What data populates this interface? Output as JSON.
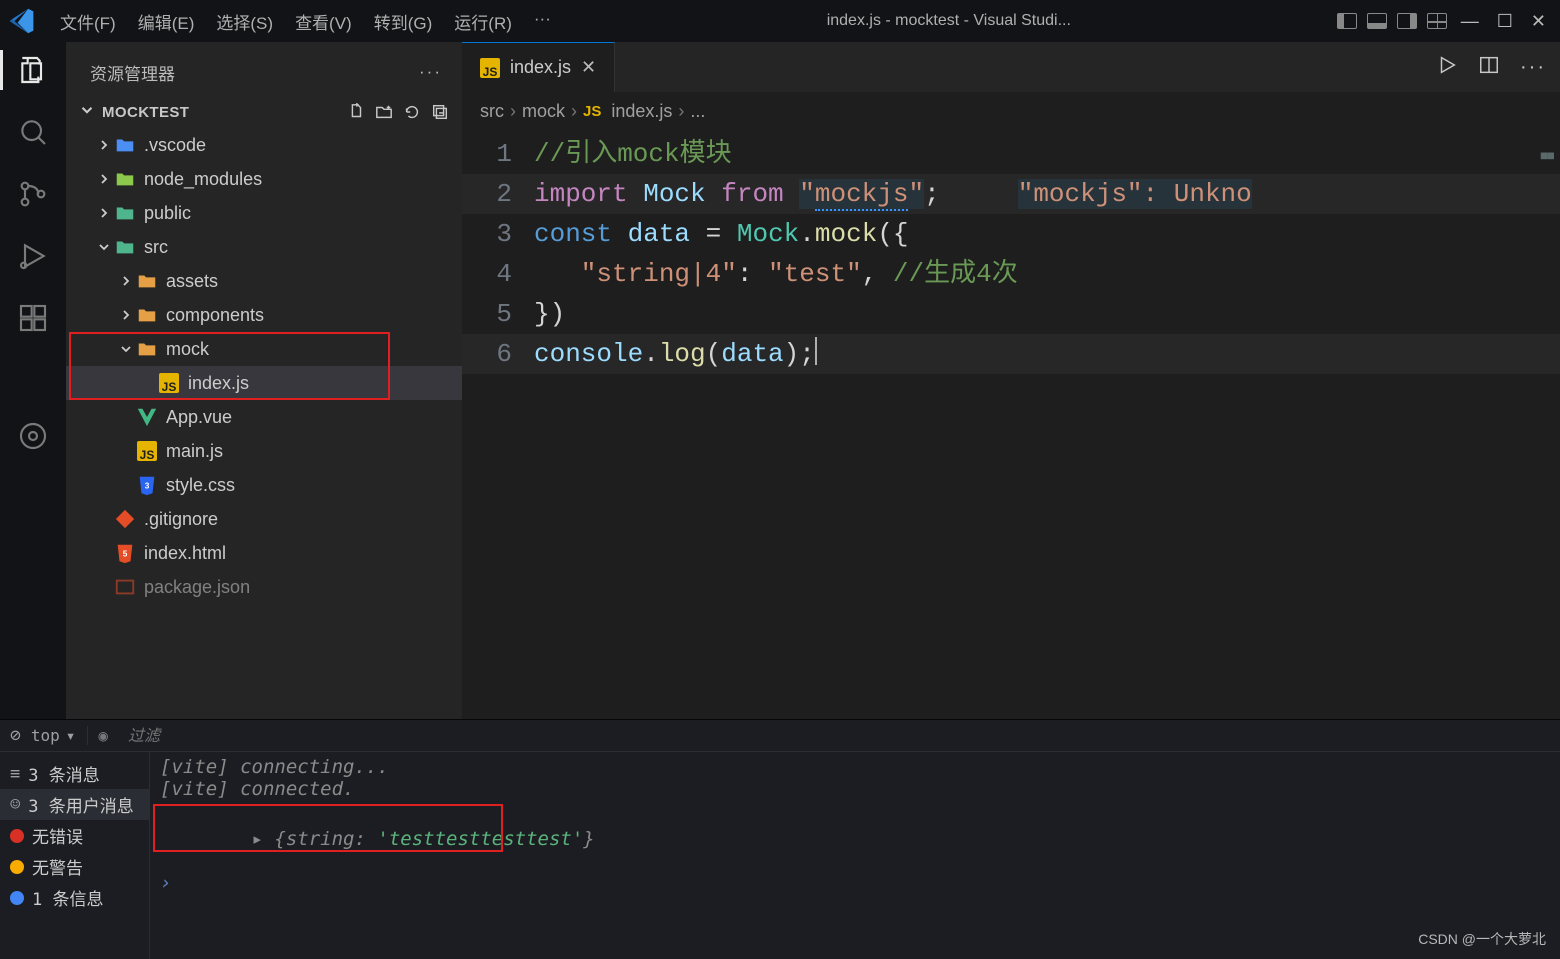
{
  "titlebar": {
    "menus": [
      "文件(F)",
      "编辑(E)",
      "选择(S)",
      "查看(V)",
      "转到(G)",
      "运行(R)",
      "···"
    ],
    "title": "index.js - mocktest - Visual Studi...",
    "win": {
      "min": "—",
      "max": "☐",
      "close": "✕"
    }
  },
  "sidebar": {
    "header": "资源管理器",
    "project": "MOCKTEST",
    "tools": {
      "newfile": "+",
      "newfolder": "+",
      "refresh": "↻",
      "collapse": "⊟"
    },
    "tree": [
      {
        "depth": 1,
        "tw": ">",
        "icon": "folder-vscode",
        "label": ".vscode",
        "name": "tree-vscode",
        "color": "#4b8ff5"
      },
      {
        "depth": 1,
        "tw": ">",
        "icon": "folder-node",
        "label": "node_modules",
        "name": "tree-node-modules",
        "color": "#8cc84b"
      },
      {
        "depth": 1,
        "tw": ">",
        "icon": "folder-public",
        "label": "public",
        "name": "tree-public",
        "color": "#4fb58d"
      },
      {
        "depth": 1,
        "tw": "v",
        "icon": "folder-src",
        "label": "src",
        "name": "tree-src",
        "color": "#4fb58d"
      },
      {
        "depth": 2,
        "tw": ">",
        "icon": "folder-assets",
        "label": "assets",
        "name": "tree-assets",
        "color": "#e59f45"
      },
      {
        "depth": 2,
        "tw": ">",
        "icon": "folder-comp",
        "label": "components",
        "name": "tree-components",
        "color": "#e59f45"
      },
      {
        "depth": 2,
        "tw": "v",
        "icon": "folder-open",
        "label": "mock",
        "name": "tree-mock",
        "color": "#e59f45",
        "boxstart": true
      },
      {
        "depth": 3,
        "tw": "",
        "icon": "js",
        "label": "index.js",
        "name": "tree-index-js",
        "sel": true,
        "boxend": true
      },
      {
        "depth": 2,
        "tw": "",
        "icon": "vue",
        "label": "App.vue",
        "name": "tree-app-vue",
        "color": "#41b883"
      },
      {
        "depth": 2,
        "tw": "",
        "icon": "js",
        "label": "main.js",
        "name": "tree-main-js"
      },
      {
        "depth": 2,
        "tw": "",
        "icon": "css",
        "label": "style.css",
        "name": "tree-style-css",
        "color": "#2965f1"
      },
      {
        "depth": 1,
        "tw": "",
        "icon": "git",
        "label": ".gitignore",
        "name": "tree-gitignore",
        "color": "#e44d26"
      },
      {
        "depth": 1,
        "tw": "",
        "icon": "html",
        "label": "index.html",
        "name": "tree-index-html",
        "color": "#e44d26"
      },
      {
        "depth": 1,
        "tw": "",
        "icon": "json",
        "label": "package.json",
        "name": "tree-package-json",
        "color": "#e44d26",
        "dim": true
      }
    ]
  },
  "tabs": {
    "active": {
      "icon": "JS",
      "label": "index.js"
    }
  },
  "breadcrumbs": [
    "src",
    "mock",
    "index.js",
    "..."
  ],
  "code": {
    "lines": [
      {
        "n": 1,
        "segments": [
          {
            "t": "//引入mock模块",
            "cls": "c-comment"
          }
        ]
      },
      {
        "n": 2,
        "hl": true,
        "segments": [
          {
            "t": "import ",
            "cls": "c-kw"
          },
          {
            "t": "Mock ",
            "cls": "c-var"
          },
          {
            "t": "from ",
            "cls": "c-kw"
          },
          {
            "t": "\"",
            "cls": "c-str errbg"
          },
          {
            "t": "mockjs",
            "cls": "c-str errbg err-squiggle"
          },
          {
            "t": "\"",
            "cls": "c-str errbg"
          },
          {
            "t": ";",
            "cls": "c-pun"
          },
          {
            "t": "     ",
            "cls": ""
          },
          {
            "t": "\"mockjs\": Unkno",
            "cls": "c-str errbg"
          }
        ]
      },
      {
        "n": 3,
        "segments": [
          {
            "t": "const ",
            "cls": "c-kw2"
          },
          {
            "t": "data ",
            "cls": "c-var"
          },
          {
            "t": "= ",
            "cls": "c-op"
          },
          {
            "t": "Mock",
            "cls": "c-type"
          },
          {
            "t": ".",
            "cls": "c-pun"
          },
          {
            "t": "mock",
            "cls": "c-fn"
          },
          {
            "t": "({",
            "cls": "c-pun"
          }
        ]
      },
      {
        "n": 4,
        "segments": [
          {
            "t": "   \"string|4\"",
            "cls": "c-str"
          },
          {
            "t": ": ",
            "cls": "c-pun"
          },
          {
            "t": "\"test\"",
            "cls": "c-str"
          },
          {
            "t": ", ",
            "cls": "c-pun"
          },
          {
            "t": "//生成4次",
            "cls": "c-comment"
          }
        ]
      },
      {
        "n": 5,
        "segments": [
          {
            "t": "})",
            "cls": "c-pun"
          }
        ]
      },
      {
        "n": 6,
        "hl": true,
        "segments": [
          {
            "t": "console",
            "cls": "c-var"
          },
          {
            "t": ".",
            "cls": "c-pun"
          },
          {
            "t": "log",
            "cls": "c-fn"
          },
          {
            "t": "(",
            "cls": "c-pun"
          },
          {
            "t": "data",
            "cls": "c-var"
          },
          {
            "t": ");",
            "cls": "c-pun"
          },
          {
            "t": "",
            "cls": "",
            "cursor": true
          }
        ]
      }
    ]
  },
  "console": {
    "toolbar": {
      "top": "top",
      "filter_placeholder": "过滤"
    },
    "side": [
      {
        "label": "3 条消息",
        "icon": "msg"
      },
      {
        "label": "3 条用户消息",
        "icon": "usr"
      },
      {
        "label": "无错误",
        "dot": "red"
      },
      {
        "label": "无警告",
        "dot": "yel"
      },
      {
        "label": "1 条信息",
        "dot": "blue"
      }
    ],
    "out": [
      "[vite] connecting...",
      "[vite] connected."
    ],
    "obj_prefix": "▸ {",
    "obj_key": "string",
    "obj_sep": ": ",
    "obj_val": "'testtesttesttest'",
    "obj_suffix": "}",
    "watermark": "CSDN @一个大萝北"
  }
}
